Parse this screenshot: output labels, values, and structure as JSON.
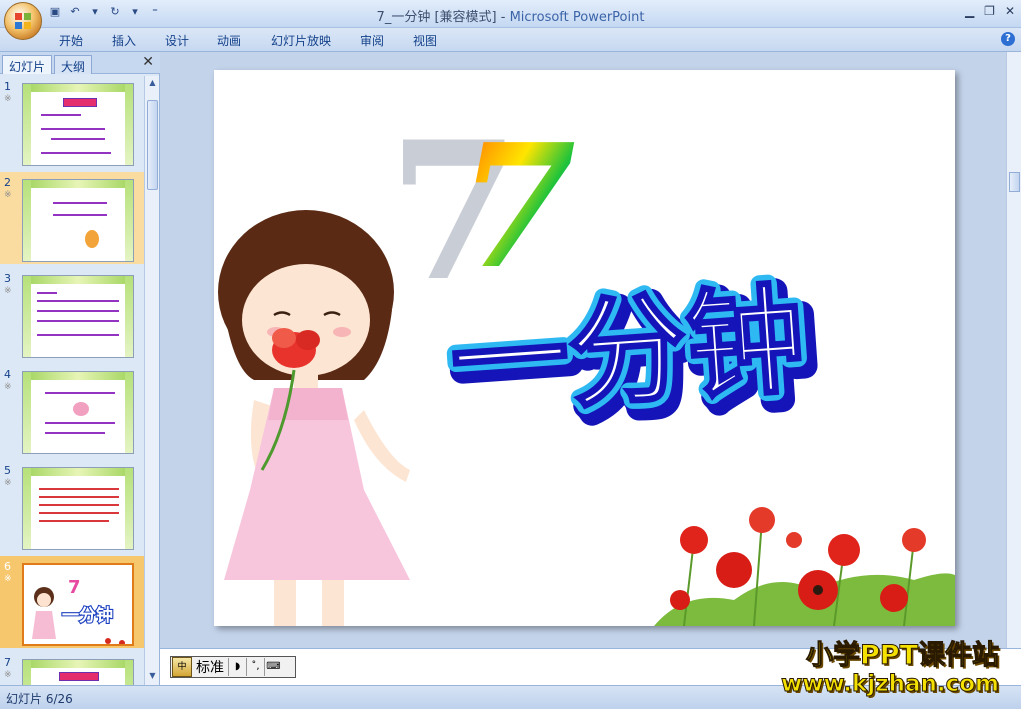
{
  "window": {
    "title_doc": "7_一分钟 [兼容模式]",
    "title_sep": " - ",
    "title_app": "Microsoft PowerPoint"
  },
  "qat": {
    "save_icon": "save-icon",
    "undo_icon": "undo-icon",
    "redo_icon": "redo-icon"
  },
  "ribbon": {
    "tabs": [
      "开始",
      "插入",
      "设计",
      "动画",
      "幻灯片放映",
      "审阅",
      "视图"
    ],
    "help_label": "?"
  },
  "panel": {
    "tab_slides": "幻灯片",
    "tab_outline": "大纲",
    "close_label": "✕",
    "slides": [
      {
        "num": "1",
        "mark": "※"
      },
      {
        "num": "2",
        "mark": "※"
      },
      {
        "num": "3",
        "mark": "※"
      },
      {
        "num": "4",
        "mark": "※"
      },
      {
        "num": "5",
        "mark": "※"
      },
      {
        "num": "6",
        "mark": "※"
      },
      {
        "num": "7",
        "mark": "※"
      }
    ],
    "selected_index": 5
  },
  "slide": {
    "number": "7",
    "title": "一分钟"
  },
  "ime": {
    "mode": "标准",
    "logo": "中"
  },
  "status": {
    "slide_position": "幻灯片 6/26"
  },
  "watermark": {
    "line1": "小学PPT课件站",
    "line2": "www.kjzhan.com"
  }
}
